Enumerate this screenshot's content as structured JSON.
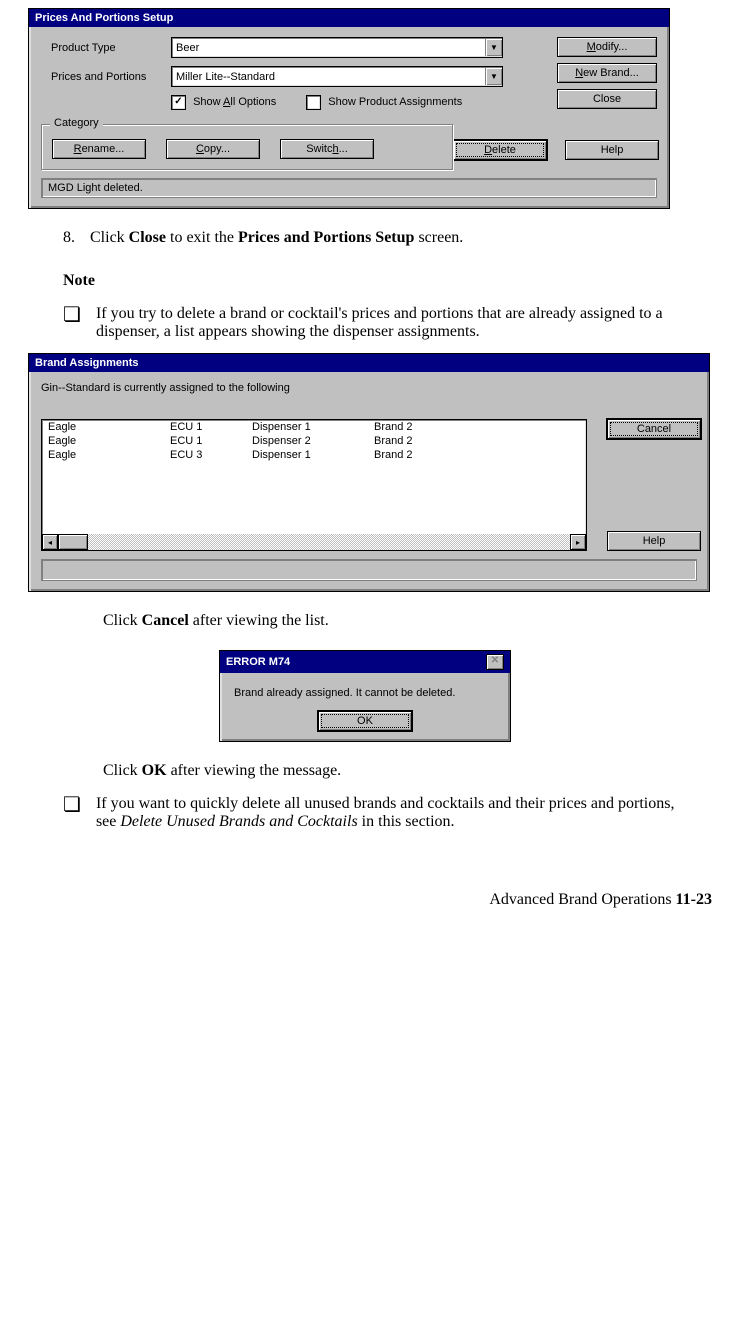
{
  "dialog1": {
    "title": "Prices And Portions Setup",
    "labels": {
      "product_type": "Product Type",
      "prices_portions": "Prices and Portions"
    },
    "product_type_value": "Beer",
    "prices_portions_value": "Miller Lite--Standard",
    "checkboxes": {
      "show_all": "Show All Options",
      "show_all_checked": "✓",
      "show_prod": "Show Product Assignments"
    },
    "buttons": {
      "modify": "Modify...",
      "new_brand": "New Brand...",
      "close": "Close",
      "delete": "Delete",
      "help": "Help",
      "rename": "Rename...",
      "copy": "Copy...",
      "switch": "Switch..."
    },
    "group_title": "Category",
    "status": "MGD Light deleted."
  },
  "step8": {
    "num": "8.",
    "text_pre": "Click ",
    "b1": "Close",
    "mid": " to exit the ",
    "b2": "Prices and Portions Setup",
    "post": " screen."
  },
  "note_heading": "Note",
  "note1": "If you try to delete a brand or cocktail's prices and portions that are already assigned to a dispenser, a list appears showing the dispenser assignments.",
  "dialog2": {
    "title": "Brand Assignments",
    "message": "Gin--Standard is currently assigned to the following",
    "rows": [
      [
        "Eagle",
        "ECU 1",
        "Dispenser 1",
        "Brand  2"
      ],
      [
        "Eagle",
        "ECU 1",
        "Dispenser 2",
        "Brand  2"
      ],
      [
        "Eagle",
        "ECU 3",
        "Dispenser 1",
        "Brand  2"
      ]
    ],
    "buttons": {
      "cancel": "Cancel",
      "help": "Help"
    }
  },
  "after_dialog2": {
    "pre": "Click ",
    "b": "Cancel",
    "post": " after viewing the list."
  },
  "dialog3": {
    "title": "ERROR M74",
    "message": "Brand already assigned. It cannot be deleted.",
    "ok": "OK"
  },
  "after_dialog3": {
    "pre": "Click ",
    "b": "OK",
    "post": " after viewing the message."
  },
  "note2": {
    "pre": "If you want to quickly delete all unused brands and cocktails and their prices and portions, see ",
    "i": "Delete Unused Brands and Cocktails",
    "post": " in this section."
  },
  "footer": {
    "text": "Advanced Brand Operations  ",
    "page": "11-23"
  }
}
